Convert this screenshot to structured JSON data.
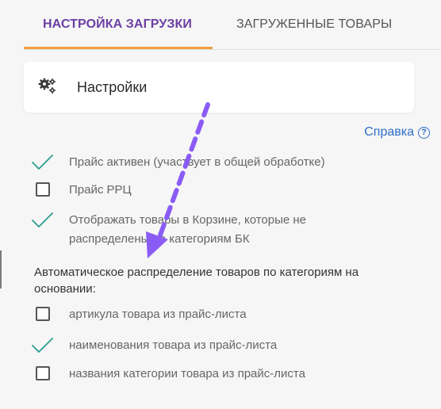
{
  "tabs": [
    {
      "label": "НАСТРОЙКА ЗАГРУЗКИ",
      "active": true
    },
    {
      "label": "ЗАГРУЖЕННЫЕ ТОВАРЫ",
      "active": false
    }
  ],
  "colors": {
    "active_tab": "#6a3fa3",
    "tab_underline": "#f0a040",
    "link": "#2f6fc8",
    "check": "#2a9d8f",
    "annotation_arrow": "#8a5cf5"
  },
  "settings_card": {
    "title": "Настройки",
    "icon": "gears-icon"
  },
  "help": {
    "label": "Справка",
    "icon": "question-circle-icon"
  },
  "options": [
    {
      "label": "Прайс активен (участвует в общей обработке)",
      "checked": true
    },
    {
      "label": "Прайс РРЦ",
      "checked": false
    },
    {
      "label": "Отображать товары в Корзине, которые не распределены по категориям БК",
      "checked": true
    }
  ],
  "distribution": {
    "heading": "Автоматическое распределение товаров по категориям на основании:",
    "options": [
      {
        "label": "артикула товара из прайс-листа",
        "checked": false
      },
      {
        "label": "наименования товара из прайс-листа",
        "checked": true
      },
      {
        "label": "названия категории товара из прайс-листа",
        "checked": false
      }
    ]
  }
}
